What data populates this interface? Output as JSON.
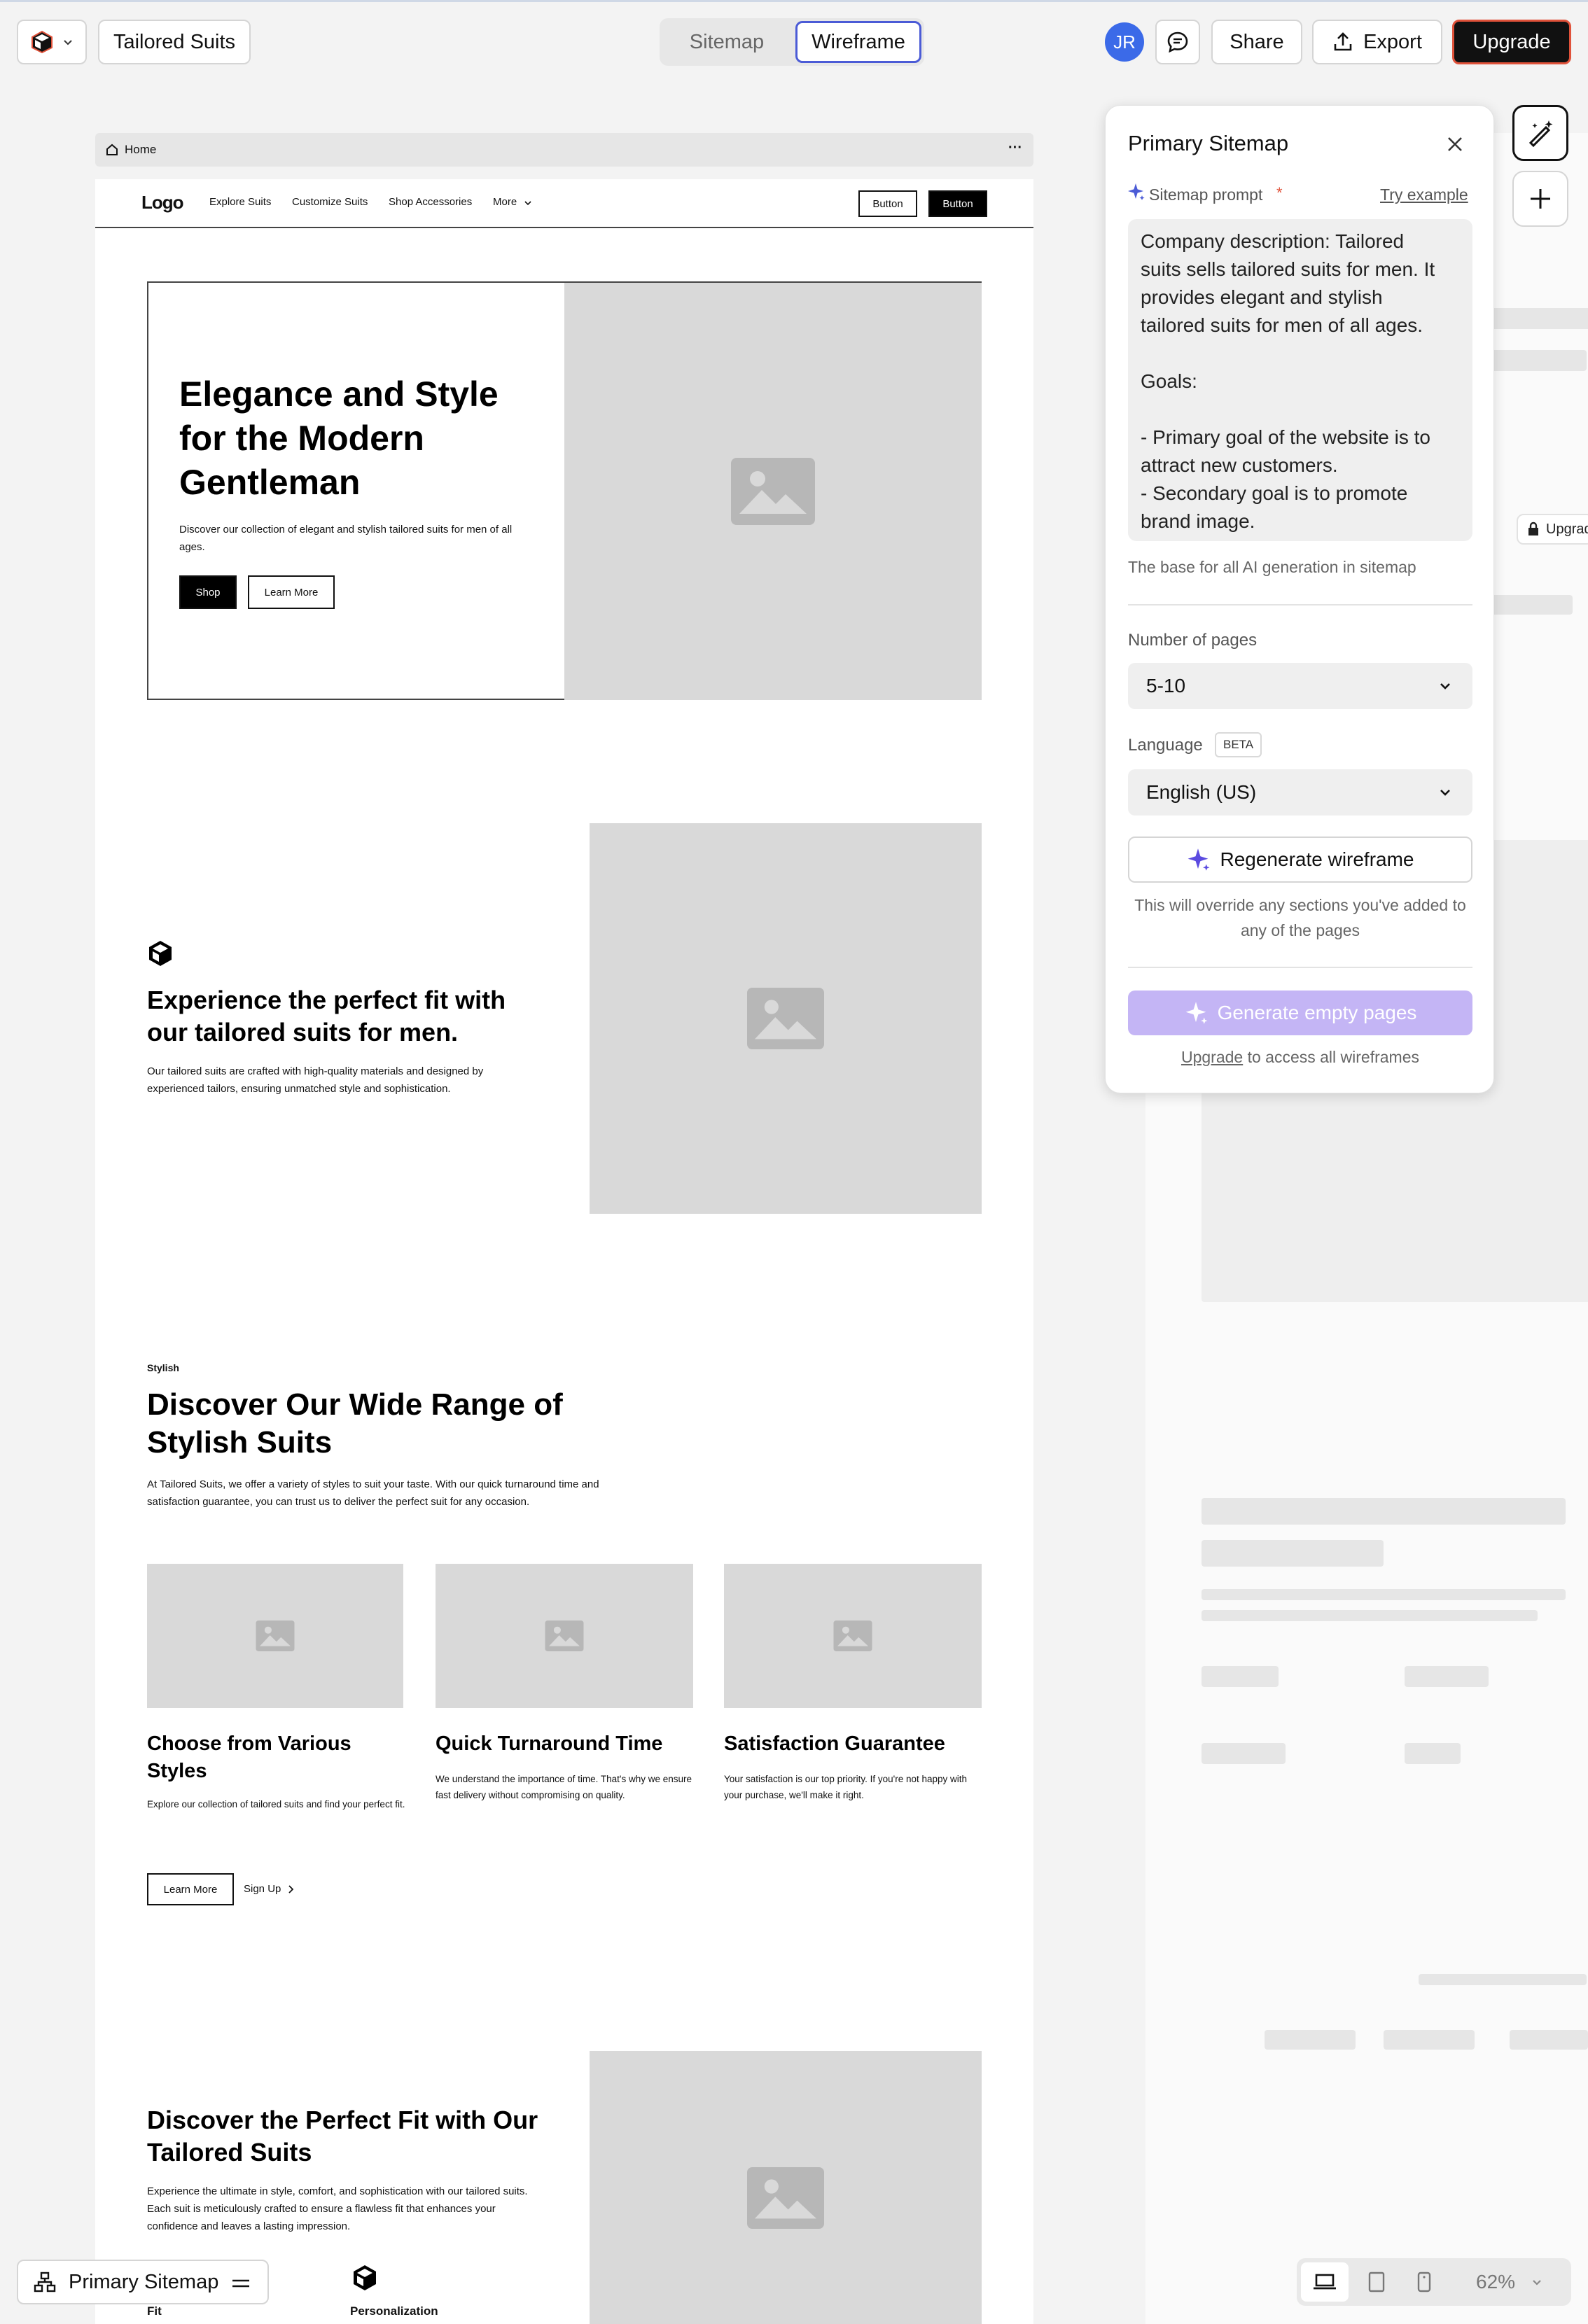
{
  "topbar": {
    "project_name": "Tailored Suits",
    "tabs": [
      "Sitemap",
      "Wireframe"
    ],
    "avatar_initials": "JR",
    "share_label": "Share",
    "export_label": "Export",
    "upgrade_label": "Upgrade"
  },
  "page_bar": {
    "name": "Home",
    "menu": "···"
  },
  "wireframe": {
    "nav": {
      "logo": "Logo",
      "links": [
        "Explore Suits",
        "Customize Suits",
        "Shop Accessories",
        "More"
      ],
      "button1": "Button",
      "button2": "Button"
    },
    "hero": {
      "title": "Elegance and Style for the Modern Gentleman",
      "body": "Discover our collection of elegant and stylish tailored suits for men of all ages.",
      "primary": "Shop",
      "secondary": "Learn More"
    },
    "feature": {
      "title": "Experience the perfect fit with our tailored suits for men.",
      "body": "Our tailored suits are crafted with high-quality materials and designed by experienced tailors, ensuring unmatched style and sophistication."
    },
    "range": {
      "eyebrow": "Stylish",
      "title": "Discover Our Wide Range of Stylish Suits",
      "body": "At Tailored Suits, we offer a variety of styles to suit your taste. With our quick turnaround time and satisfaction guarantee, you can trust us to deliver the perfect suit for any occasion.",
      "cards": [
        {
          "title": "Choose from Various Styles",
          "body": "Explore our collection of tailored suits and find your perfect fit."
        },
        {
          "title": "Quick Turnaround Time",
          "body": "We understand the importance of time. That's why we ensure fast delivery without compromising on quality."
        },
        {
          "title": "Satisfaction Guarantee",
          "body": "Your satisfaction is our top priority. If you're not happy with your purchase, we'll make it right."
        }
      ],
      "learn_more": "Learn More",
      "sign_up": "Sign Up"
    },
    "fit": {
      "title": "Discover the Perfect Fit with Our Tailored Suits",
      "body": "Experience the ultimate in style, comfort, and sophistication with our tailored suits. Each suit is meticulously crafted to ensure a flawless fit that enhances your confidence and leaves a lasting impression.",
      "item1": "Fit",
      "item2": "Personalization"
    }
  },
  "panel": {
    "title": "Primary Sitemap",
    "prompt_label": "Sitemap prompt",
    "required_mark": "*",
    "try_example": "Try example",
    "prompt_lines": [
      "Company description: Tailored",
      "suits sells tailored suits for men. It",
      "provides elegant and stylish",
      "tailored suits for men of all ages.",
      "",
      "Goals:",
      "",
      "- Primary goal of the website is to",
      "attract new customers.",
      "- Secondary goal is to promote",
      "brand image."
    ],
    "prompt_hint": "The base for all AI generation in sitemap",
    "pages_label": "Number of pages",
    "pages_value": "5-10",
    "language_label": "Language",
    "beta_badge": "BETA",
    "language_value": "English (US)",
    "regenerate_label": "Regenerate wireframe",
    "override_note": "This will override any sections you've added to any of the pages",
    "generate_empty_label": "Generate empty pages",
    "upgrade_link": "Upgrade",
    "upgrade_suffix": "to access all wireframes"
  },
  "side_badge": "Upgrad",
  "bottom": {
    "sitemap_label": "Primary Sitemap",
    "zoom": "62%"
  },
  "colors": {
    "accent": "#4b5bd6",
    "avatar": "#3b6ae8",
    "upgrade_bg": "#111111",
    "upgrade_border": "#e0523a",
    "generate_disabled": "#c4b5f5",
    "placeholder": "#d9d9d9"
  }
}
